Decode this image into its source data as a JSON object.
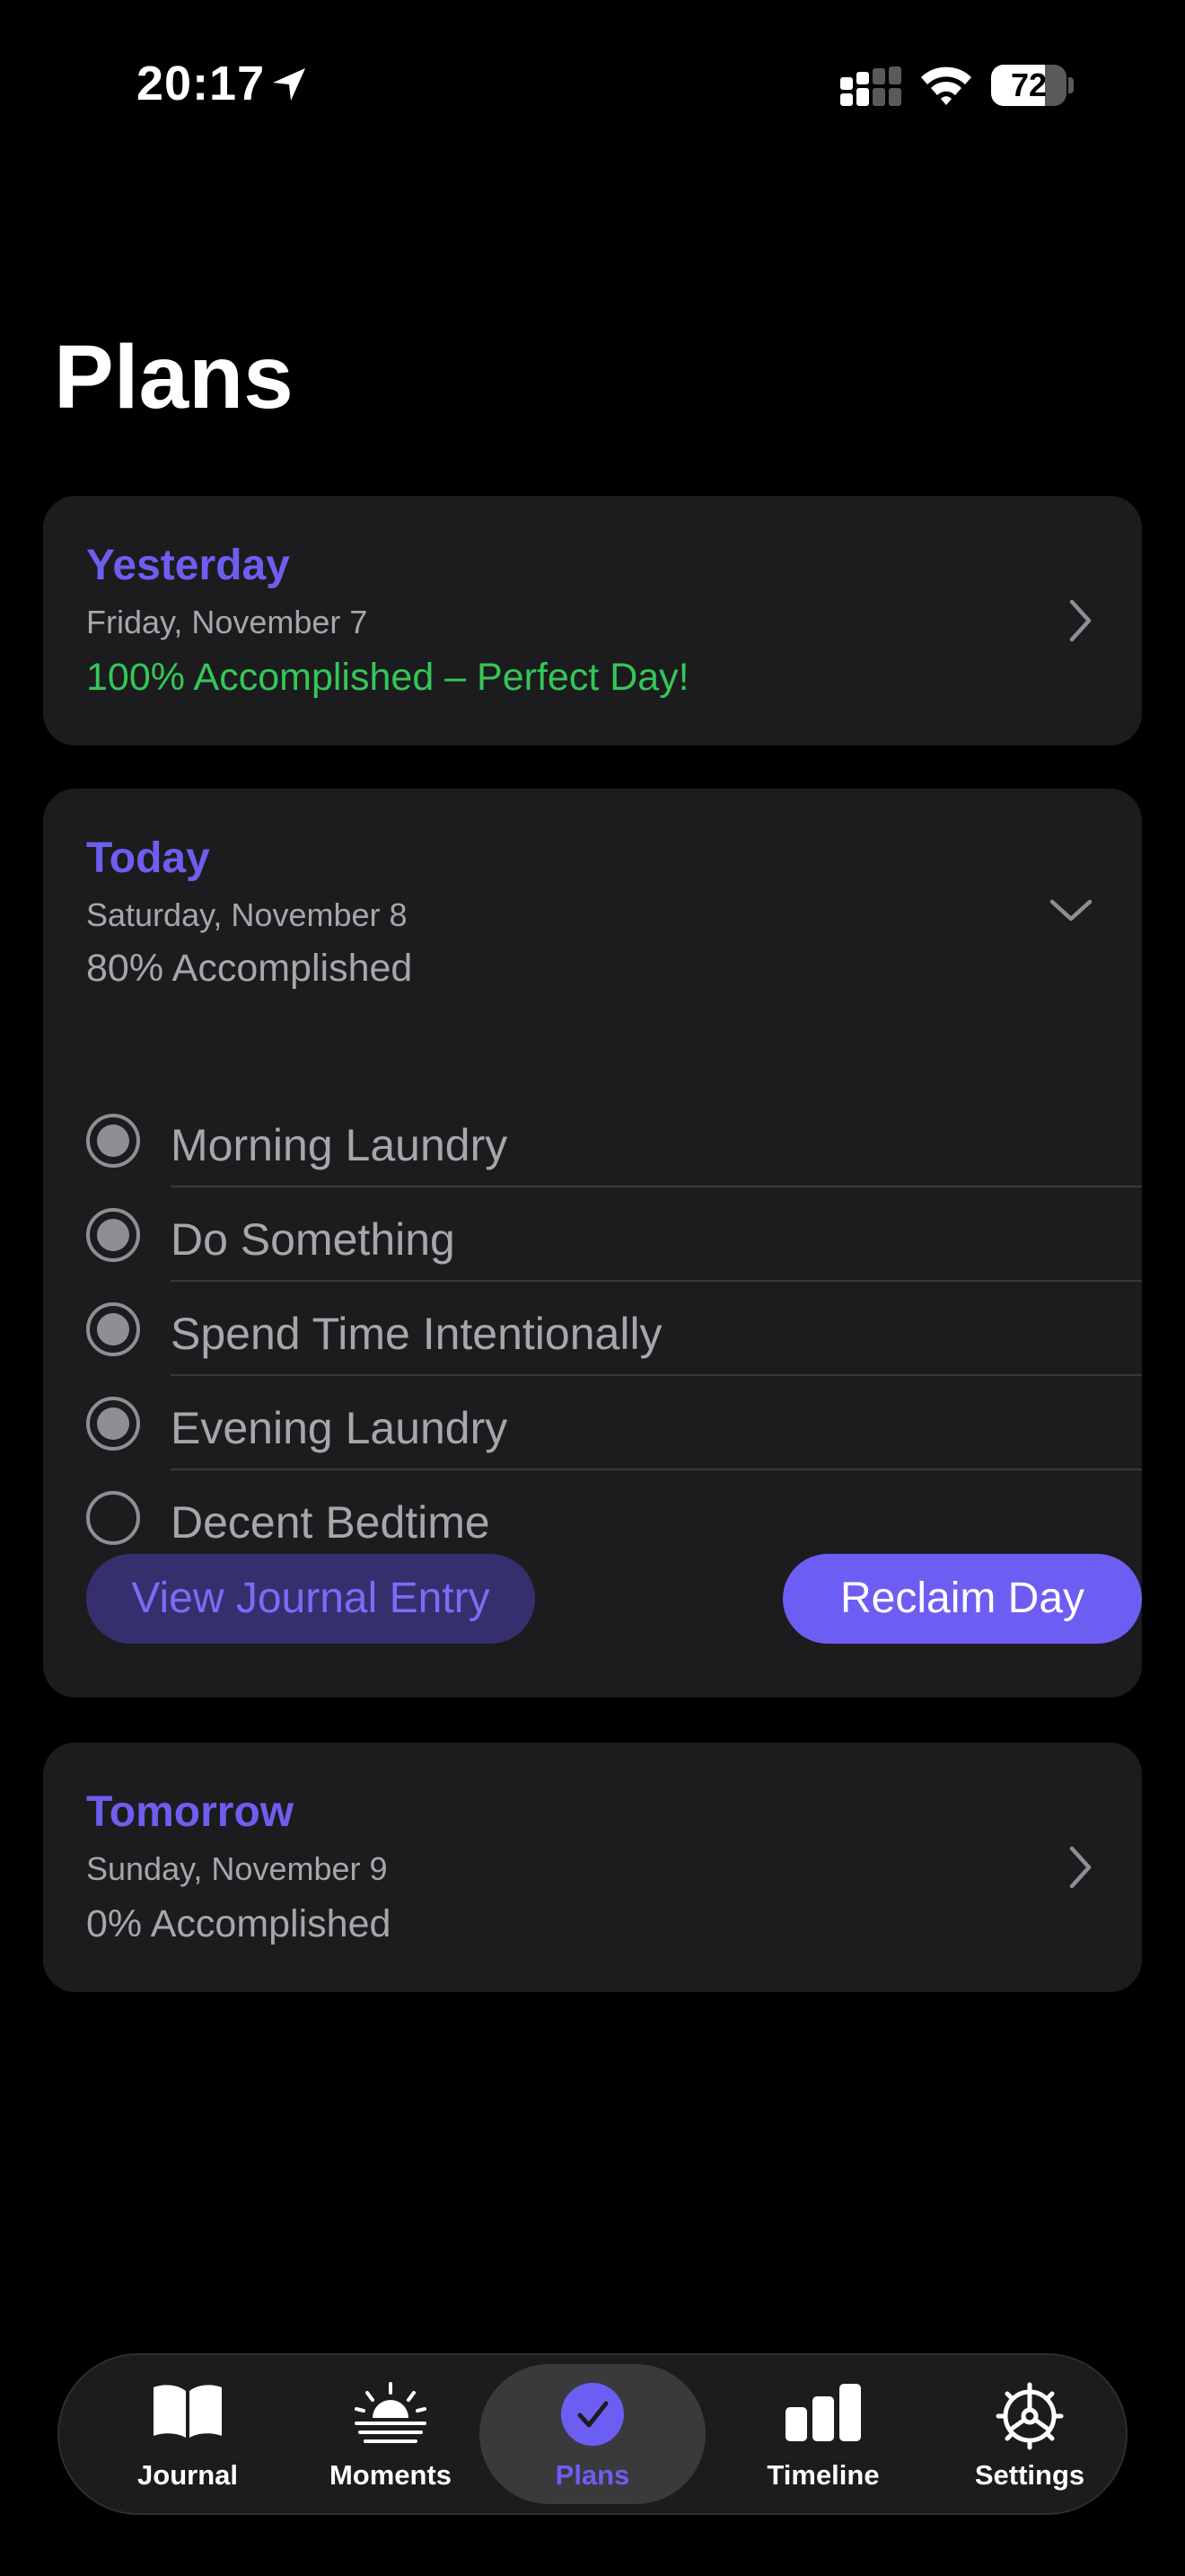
{
  "status_bar": {
    "time": "20:17",
    "battery": "72",
    "battery_level": 0.72
  },
  "page_title": "Plans",
  "yesterday": {
    "label": "Yesterday",
    "date": "Friday, November 7",
    "status": "100% Accomplished – Perfect Day!",
    "status_color": "#34c759"
  },
  "today": {
    "label": "Today",
    "date": "Saturday, November 8",
    "status": "80% Accomplished",
    "tasks": [
      {
        "label": "Morning Laundry",
        "checked": true
      },
      {
        "label": "Do Something",
        "checked": true
      },
      {
        "label": "Spend Time Intentionally",
        "checked": true
      },
      {
        "label": "Evening Laundry",
        "checked": true
      },
      {
        "label": "Decent Bedtime",
        "checked": false
      }
    ],
    "view_journal_label": "View Journal Entry",
    "reclaim_label": "Reclaim Day"
  },
  "tomorrow": {
    "label": "Tomorrow",
    "date": "Sunday, November 9",
    "status": "0% Accomplished"
  },
  "tab_bar": {
    "active": "Plans",
    "tabs": [
      {
        "label": "Journal",
        "icon": "book-icon"
      },
      {
        "label": "Moments",
        "icon": "sunrise-icon"
      },
      {
        "label": "Plans",
        "icon": "checkmark-circle-icon"
      },
      {
        "label": "Timeline",
        "icon": "bar-chart-icon"
      },
      {
        "label": "Settings",
        "icon": "gear-icon"
      }
    ]
  },
  "colors": {
    "accent": "#6d5ef3",
    "label_accent": "#6e5ef0",
    "card_bg": "#1c1c1e",
    "success": "#34c759"
  }
}
